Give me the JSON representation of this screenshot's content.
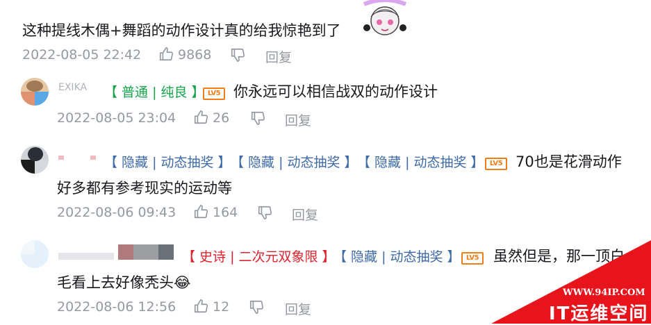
{
  "top_comment": {
    "text": "这种提线木偶+舞蹈的动作设计真的给我惊艳到了",
    "date": "2022-08-05 22:42",
    "likes": "9868",
    "reply_label": "回复"
  },
  "replies": [
    {
      "username": "EXIKA",
      "tags": [
        "【 普通 | 纯良 】"
      ],
      "level": "LV5",
      "text_line1": "你永远可以相信战双的动作设计",
      "text_line2": "",
      "date": "2022-08-05 23:04",
      "likes": "26",
      "reply_label": "回复"
    },
    {
      "username": "",
      "tags": [
        "【 隐藏 | 动态抽奖 】",
        "【 隐藏 | 动态抽奖 】",
        "【 隐藏 | 动态抽奖 】"
      ],
      "level": "LV5",
      "text_line1": "70也是花滑动作",
      "text_line2": "好多都有参考现实的运动等",
      "date": "2022-08-06 09:43",
      "likes": "164",
      "reply_label": "回复"
    },
    {
      "username": "",
      "tags": [
        "【 史诗 | 二次元双象限 】",
        "【 隐藏 | 动态抽奖 】"
      ],
      "level": "LV5",
      "text_line1": "虽然但是，那一顶白",
      "text_line2": "毛看上去好像秃头😂",
      "date": "2022-08-06 12:56",
      "likes": "12",
      "reply_label": "回复"
    }
  ],
  "watermark": {
    "url": "WWW.94IP.COM",
    "brand": "IT运维空间"
  },
  "colors": {
    "meta": "#9499a0",
    "tag_green": "#16a34a",
    "tag_blue": "#3e6aa8",
    "tag_red": "#e0222e",
    "level_orange": "#f07e17",
    "watermark_red": "#e8141c"
  }
}
